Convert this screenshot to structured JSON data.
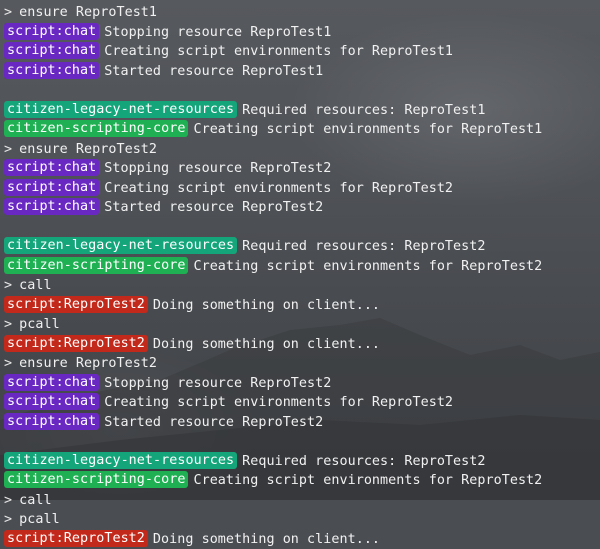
{
  "colors": {
    "chat": "#6a28c2",
    "legacy": "#15a57a",
    "core": "#1eb052",
    "client": "#c3291b"
  },
  "lines": [
    {
      "type": "cmd",
      "text": "ensure ReproTest1"
    },
    {
      "type": "log",
      "tag": "script:chat",
      "tagColor": "chat",
      "text": "Stopping resource ReproTest1"
    },
    {
      "type": "log",
      "tag": "script:chat",
      "tagColor": "chat",
      "text": "Creating script environments for ReproTest1"
    },
    {
      "type": "log",
      "tag": "script:chat",
      "tagColor": "chat",
      "text": "Started resource ReproTest1"
    },
    {
      "type": "blank"
    },
    {
      "type": "log",
      "tag": "citizen-legacy-net-resources",
      "tagColor": "legacy",
      "text": "Required resources: ReproTest1"
    },
    {
      "type": "log",
      "tag": "citizen-scripting-core",
      "tagColor": "core",
      "text": "Creating script environments for ReproTest1"
    },
    {
      "type": "cmd",
      "text": "ensure ReproTest2"
    },
    {
      "type": "log",
      "tag": "script:chat",
      "tagColor": "chat",
      "text": "Stopping resource ReproTest2"
    },
    {
      "type": "log",
      "tag": "script:chat",
      "tagColor": "chat",
      "text": "Creating script environments for ReproTest2"
    },
    {
      "type": "log",
      "tag": "script:chat",
      "tagColor": "chat",
      "text": "Started resource ReproTest2"
    },
    {
      "type": "blank"
    },
    {
      "type": "log",
      "tag": "citizen-legacy-net-resources",
      "tagColor": "legacy",
      "text": "Required resources: ReproTest2"
    },
    {
      "type": "log",
      "tag": "citizen-scripting-core",
      "tagColor": "core",
      "text": "Creating script environments for ReproTest2"
    },
    {
      "type": "cmd",
      "text": "call"
    },
    {
      "type": "log",
      "tag": "script:ReproTest2",
      "tagColor": "client",
      "text": "Doing something on client..."
    },
    {
      "type": "cmd",
      "text": "pcall"
    },
    {
      "type": "log",
      "tag": "script:ReproTest2",
      "tagColor": "client",
      "text": "Doing something on client..."
    },
    {
      "type": "cmd",
      "text": "ensure ReproTest2"
    },
    {
      "type": "log",
      "tag": "script:chat",
      "tagColor": "chat",
      "text": "Stopping resource ReproTest2"
    },
    {
      "type": "log",
      "tag": "script:chat",
      "tagColor": "chat",
      "text": "Creating script environments for ReproTest2"
    },
    {
      "type": "log",
      "tag": "script:chat",
      "tagColor": "chat",
      "text": "Started resource ReproTest2"
    },
    {
      "type": "blank"
    },
    {
      "type": "log",
      "tag": "citizen-legacy-net-resources",
      "tagColor": "legacy",
      "text": "Required resources: ReproTest2"
    },
    {
      "type": "log",
      "tag": "citizen-scripting-core",
      "tagColor": "core",
      "text": "Creating script environments for ReproTest2"
    },
    {
      "type": "cmd",
      "text": "call"
    },
    {
      "type": "cmd",
      "text": "pcall"
    },
    {
      "type": "log",
      "tag": "script:ReproTest2",
      "tagColor": "client",
      "text": "Doing something on client..."
    }
  ],
  "prompt_glyph": ">"
}
